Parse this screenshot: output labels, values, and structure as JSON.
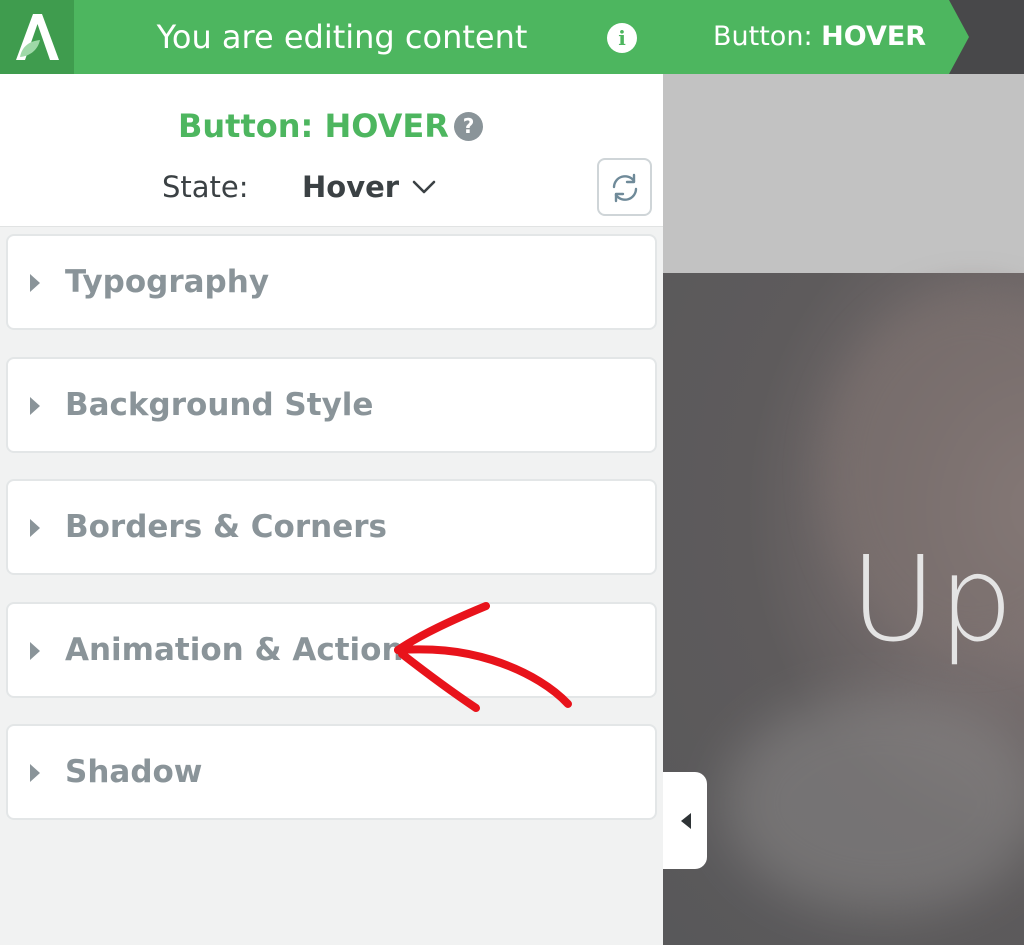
{
  "topbar": {
    "title": "You are editing content",
    "info_icon": "info-icon",
    "breadcrumb_prefix": "Button: ",
    "breadcrumb_state": "HOVER"
  },
  "panel": {
    "element_title": "Button: HOVER",
    "state_label": "State:",
    "state_value": "Hover",
    "sections": [
      {
        "label": "Typography"
      },
      {
        "label": "Background Style"
      },
      {
        "label": "Borders & Corners"
      },
      {
        "label": "Animation & Action"
      },
      {
        "label": "Shadow"
      }
    ]
  },
  "preview": {
    "hero_text": "Ups"
  },
  "colors": {
    "brand_green": "#4db65f",
    "dark_bar": "#48484a",
    "muted_text": "#8a9499",
    "annotation_red": "#e8131b"
  }
}
